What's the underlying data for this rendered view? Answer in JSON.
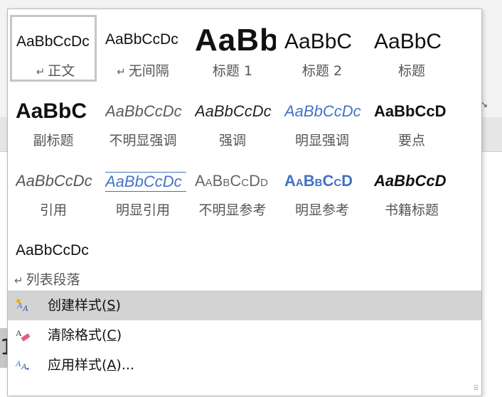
{
  "styles": [
    {
      "sample": "AaBbCcDc",
      "label": "正文",
      "mark": "↵",
      "variant": "s-zhengwen",
      "selected": true
    },
    {
      "sample": "AaBbCcDc",
      "label": "无间隔",
      "mark": "↵",
      "variant": "s-zhengwen"
    },
    {
      "sample": "AaBb",
      "label": "标题 1",
      "variant": "s-h1"
    },
    {
      "sample": "AaBbC",
      "label": "标题 2",
      "variant": "s-h2"
    },
    {
      "sample": "AaBbC",
      "label": "标题",
      "variant": "s-title"
    },
    {
      "sample": "AaBbC",
      "label": "副标题",
      "variant": "s-subtitle"
    },
    {
      "sample": "AaBbCcDc",
      "label": "不明显强调",
      "variant": "s-subtle-em"
    },
    {
      "sample": "AaBbCcDc",
      "label": "强调",
      "variant": "s-em"
    },
    {
      "sample": "AaBbCcDc",
      "label": "明显强调",
      "variant": "s-intense-em"
    },
    {
      "sample": "AaBbCcD",
      "label": "要点",
      "variant": "s-strong"
    },
    {
      "sample": "AaBbCcDc",
      "label": "引用",
      "variant": "s-quote"
    },
    {
      "sample": "AaBbCcDc",
      "label": "明显引用",
      "variant": "s-intense-quote"
    },
    {
      "sample": "AaBbCcDd",
      "label": "不明显参考",
      "variant": "s-subtle-ref"
    },
    {
      "sample": "AaBbCcD",
      "label": "明显参考",
      "variant": "s-intense-ref"
    },
    {
      "sample": "AaBbCcD",
      "label": "书籍标题",
      "variant": "s-book"
    },
    {
      "sample": "AaBbCcDc",
      "label": "列表段落",
      "mark": "↵",
      "variant": "s-list",
      "left_label": true
    }
  ],
  "menu": {
    "create": {
      "pre": "创建样式(",
      "key": "S",
      "post": ")",
      "icon": "new-style-icon"
    },
    "clear": {
      "pre": "清除格式(",
      "key": "C",
      "post": ")",
      "icon": "eraser-icon"
    },
    "apply": {
      "pre": "应用样式(",
      "key": "A",
      "post": ")...",
      "icon": "apply-styles-icon"
    }
  },
  "colors": {
    "accent": "#4472c4",
    "hover": "#d3d3d3",
    "selected_border": "#c6c6c6"
  }
}
